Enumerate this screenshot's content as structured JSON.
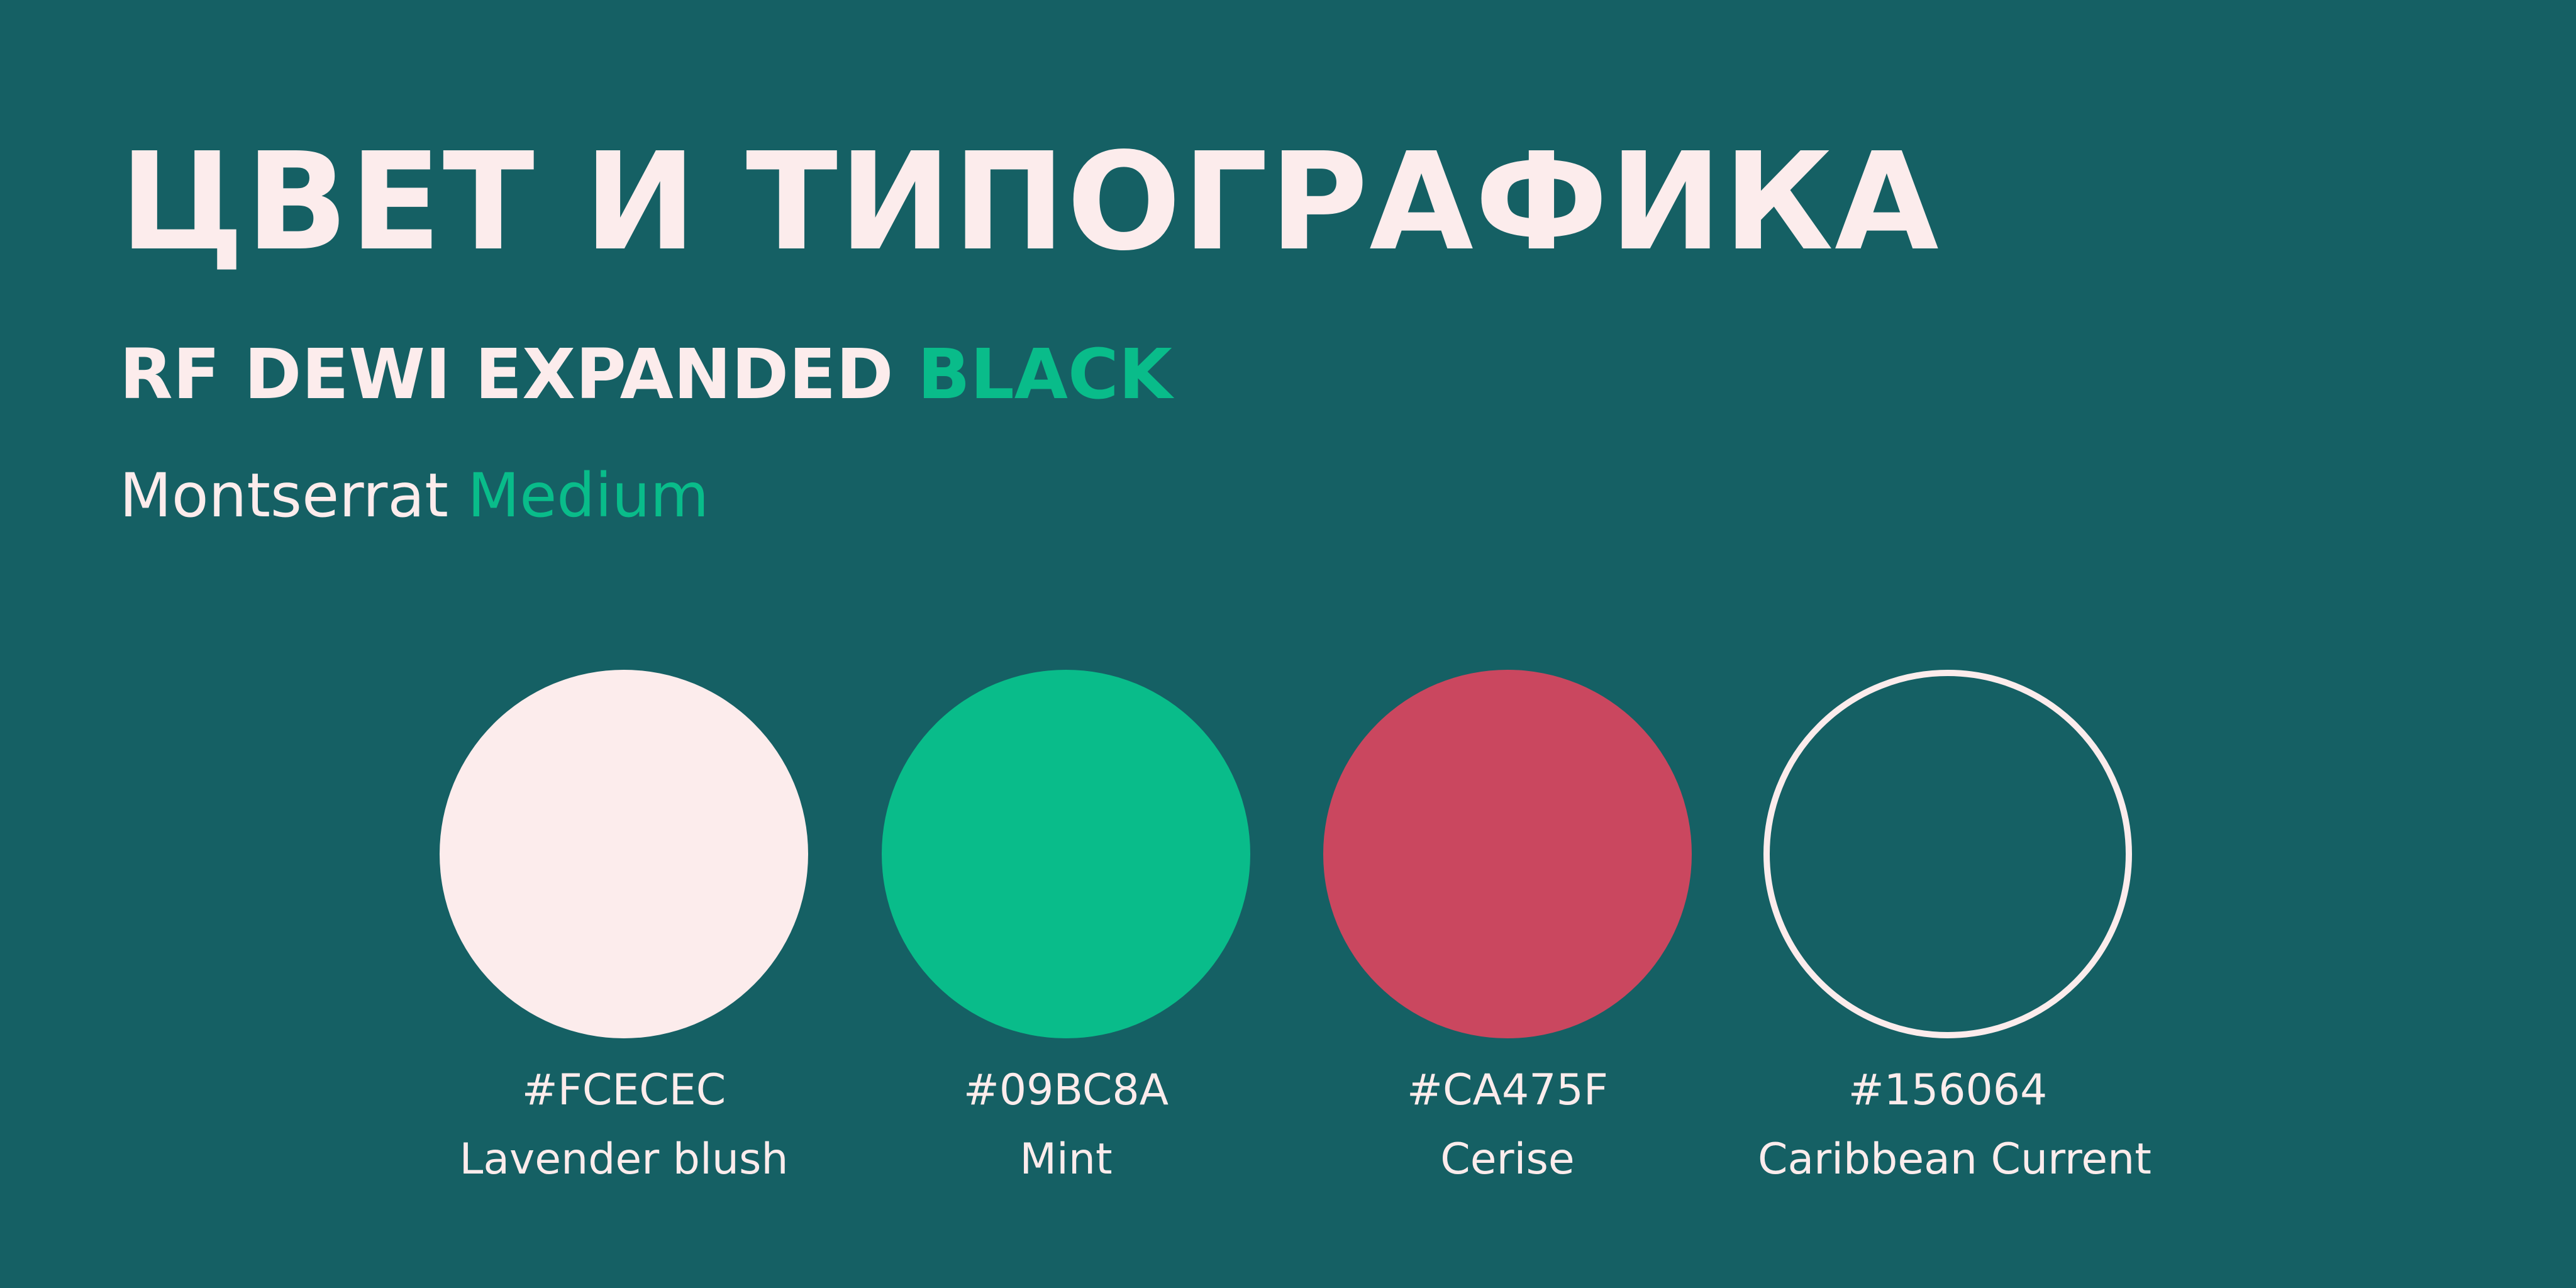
{
  "heading": {
    "title": "ЦВЕТ И ТИПОГРАФИКА",
    "display_font": {
      "family": "RF DEWI EXPANDED",
      "weight": "BLACK"
    },
    "text_font": {
      "family": "Montserrat",
      "weight": "Medium"
    }
  },
  "palette": [
    {
      "hex": "#FCECEC",
      "name": "Lavender blush"
    },
    {
      "hex": "#09BC8A",
      "name": "Mint"
    },
    {
      "hex": "#CA475F",
      "name": "Cerise"
    },
    {
      "hex": "#156064",
      "name": "Caribbean Current"
    }
  ]
}
